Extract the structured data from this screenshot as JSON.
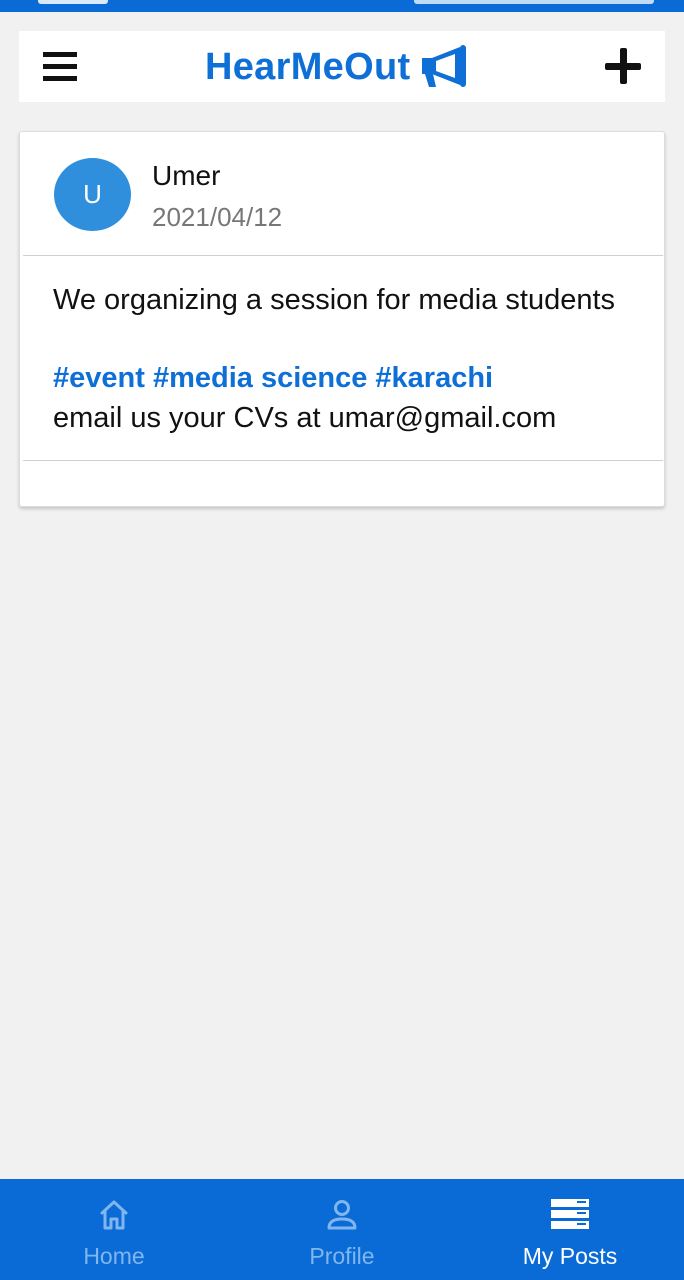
{
  "header": {
    "title": "HearMeOut",
    "brand_color": "#0e6fd6",
    "menu_icon": "hamburger-menu-icon",
    "title_icon": "megaphone-icon",
    "add_icon": "plus-icon"
  },
  "post": {
    "avatar_initial": "U",
    "author": "Umer",
    "date": "2021/04/12",
    "body": "We organizing a session for media students",
    "hashtags": "#event #media science #karachi",
    "email_line": "email us your CVs at umar@gmail.com"
  },
  "bottom_nav": {
    "background": "#0a6bd6",
    "active": "My Posts",
    "items": [
      {
        "label": "Home",
        "icon": "home-icon"
      },
      {
        "label": "Profile",
        "icon": "profile-icon"
      },
      {
        "label": "My Posts",
        "icon": "posts-icon"
      }
    ]
  }
}
